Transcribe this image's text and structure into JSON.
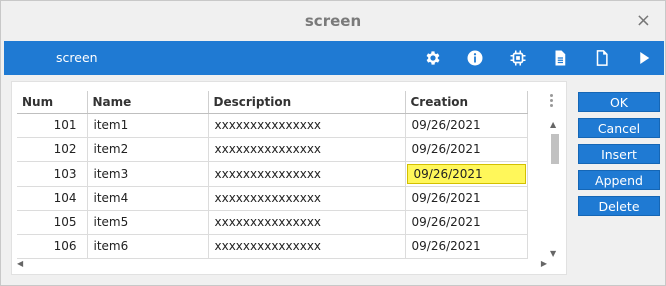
{
  "window": {
    "title": "screen",
    "close_glyph": "×"
  },
  "toolbar": {
    "title": "screen",
    "icons": [
      "gear-icon",
      "info-icon",
      "chip-icon",
      "document-icon",
      "new-page-icon",
      "play-icon"
    ]
  },
  "table": {
    "columns": [
      "Num",
      "Name",
      "Description",
      "Creation"
    ],
    "rows": [
      {
        "num": "101",
        "name": "item1",
        "description": "xxxxxxxxxxxxxxx",
        "creation": "09/26/2021"
      },
      {
        "num": "102",
        "name": "item2",
        "description": "xxxxxxxxxxxxxxx",
        "creation": "09/26/2021"
      },
      {
        "num": "103",
        "name": "item3",
        "description": "xxxxxxxxxxxxxxx",
        "creation": "09/26/2021"
      },
      {
        "num": "104",
        "name": "item4",
        "description": "xxxxxxxxxxxxxxx",
        "creation": "09/26/2021"
      },
      {
        "num": "105",
        "name": "item5",
        "description": "xxxxxxxxxxxxxxx",
        "creation": "09/26/2021"
      },
      {
        "num": "106",
        "name": "item6",
        "description": "xxxxxxxxxxxxxxx",
        "creation": "09/26/2021"
      }
    ],
    "selected_row": 2,
    "selected_column": "creation",
    "selected_color": "#fff75a"
  },
  "buttons": {
    "ok": "OK",
    "cancel": "Cancel",
    "insert": "Insert",
    "append": "Append",
    "delete": "Delete"
  },
  "colors": {
    "accent": "#1f7ad3"
  }
}
